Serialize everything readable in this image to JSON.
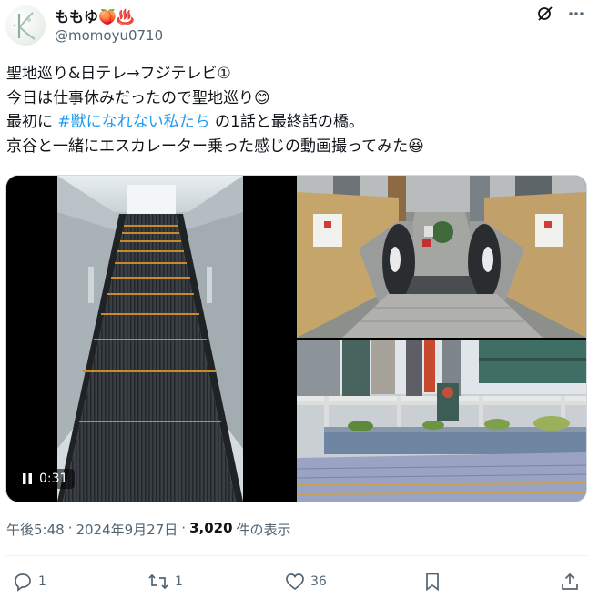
{
  "user": {
    "display_name": "ももゆ🍑♨️",
    "handle": "@momoyu0710"
  },
  "tweet": {
    "line1": "聖地巡り&日テレ→フジテレビ①",
    "line2": "今日は仕事休みだったので聖地巡り😊",
    "line3_pre": "最初に ",
    "line3_hashtag": "#獣になれない私たち",
    "line3_post": " の1話と最終話の橋。",
    "line4": "京谷と一緒にエスカレーター乗った感じの動画撮ってみた😆"
  },
  "video": {
    "time": "0:31",
    "play_state_icon": "pause-icon"
  },
  "meta": {
    "time": "午後5:48",
    "sep1": "·",
    "date": "2024年9月27日",
    "sep2": "·",
    "views_count": "3,020",
    "views_label": "件の表示"
  },
  "actions": {
    "replies": "1",
    "reposts": "1",
    "likes": "36"
  },
  "colors": {
    "accent": "#1d9bf0",
    "secondary_text": "#536471"
  }
}
